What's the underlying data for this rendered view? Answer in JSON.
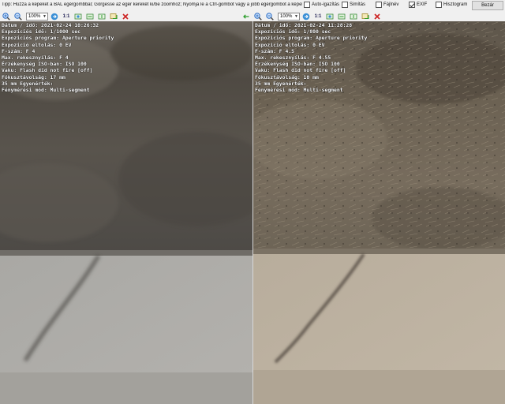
{
  "topbar": {
    "tip": "Tipp: Húzza a képeket a BAL egérgombbal; Görgesse az egér kerekét ki/be zoomhoz; Nyomja le a Ctrl-gombot vagy a jobb egérgombot a képek független  mozg",
    "options": [
      {
        "label": "Auto-igazítás",
        "checked": false
      },
      {
        "label": "Simítás",
        "checked": false
      },
      {
        "label": "Fájlnév",
        "checked": false
      },
      {
        "label": "EXIF",
        "checked": true
      },
      {
        "label": "Hisztogram",
        "checked": false
      }
    ],
    "close_label": "Bezár"
  },
  "toolbars": {
    "left": {
      "zoom": "100%",
      "one_to_one": "1:1"
    },
    "right": {
      "zoom": "100%",
      "one_to_one": "1:1"
    }
  },
  "icons": [
    "zoom-in-icon",
    "zoom-out-icon",
    "arrow-right-icon",
    "one-to-one",
    "fit-icon",
    "fit-width-icon",
    "fit-height-icon",
    "rotate-icon",
    "delete-icon"
  ],
  "left_exif": [
    "Dátum / idő: 2021-02-24 10:26:32",
    "Expozíciós idő: 1/1000 sec",
    "Expozíciós program: Aperture priority",
    "Expozíció eltolás: 0 EV",
    "F-szám: F 4",
    "Max. rekesznyílás: F 4",
    "Érzékenység ISO-ban: ISO 100",
    "Vaku: Flash did not fire [off]",
    "Fókusztávolság: 17 mm",
    "35 mm Egyenérték:",
    "Fénymérési mód: Multi-segment"
  ],
  "right_exif": [
    "Dátum / idő: 2021-02-24 11:28:28",
    "Expozíciós idő: 1/800 sec",
    "Expozíciós program: Aperture priority",
    "Expozíció eltolás: 0 EV",
    "F-szám: F 4.5",
    "Max. rekesznyílás: F 4.55",
    "Érzékenység ISO-ban: ISO 100",
    "Vaku: Flash did not fire [off]",
    "Fókusztávolság: 10 mm",
    "35 mm Egyenérték:",
    "Fénymérési mód: Multi-segment"
  ],
  "colors": {
    "accent_green": "#2a9d2a",
    "delete_red": "#cc2222",
    "zoom_blue": "#2b6cc4"
  }
}
